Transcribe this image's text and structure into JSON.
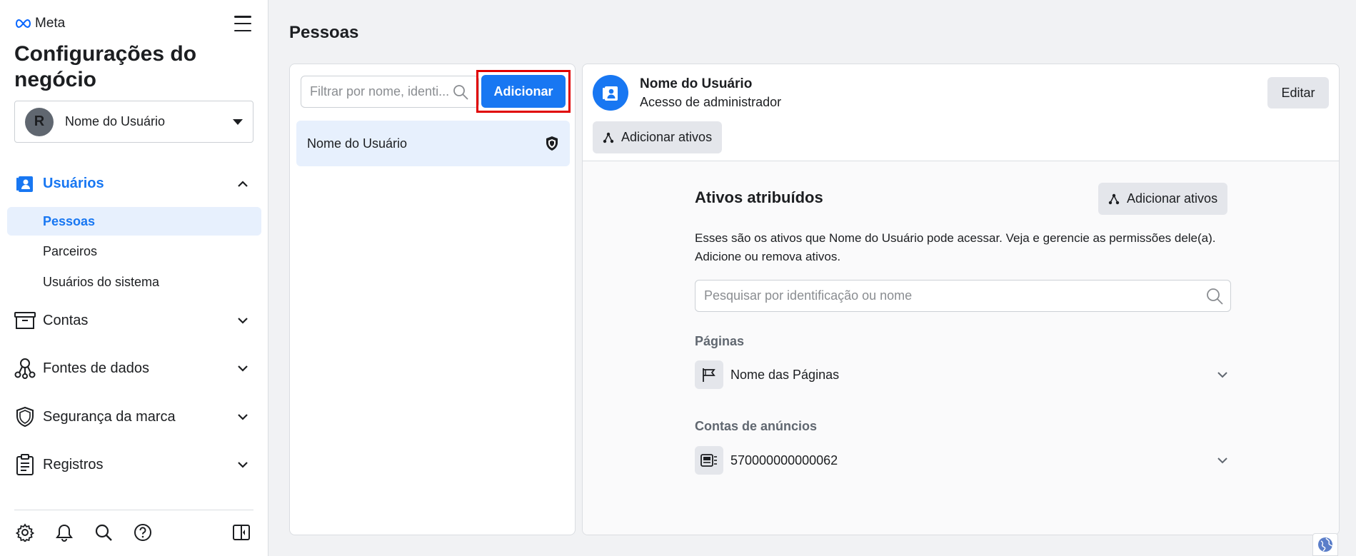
{
  "sidebar": {
    "brand": "Meta",
    "title": "Configurações do negócio",
    "business_selector": {
      "initial": "R",
      "name": "Nome do Usuário"
    },
    "sections": [
      {
        "label": "Usuários",
        "icon": "users-badge-icon",
        "expanded": true,
        "items": [
          {
            "label": "Pessoas",
            "selected": true
          },
          {
            "label": "Parceiros"
          },
          {
            "label": "Usuários do sistema"
          }
        ]
      },
      {
        "label": "Contas",
        "icon": "archive-box-icon"
      },
      {
        "label": "Fontes de dados",
        "icon": "data-sources-icon"
      },
      {
        "label": "Segurança da marca",
        "icon": "shield-icon"
      },
      {
        "label": "Registros",
        "icon": "clipboard-icon"
      }
    ],
    "bottom_icons": [
      "gear-icon",
      "bell-icon",
      "search-icon",
      "help-icon",
      "panel-toggle-icon"
    ]
  },
  "main": {
    "page_title": "Pessoas",
    "list": {
      "filter_placeholder": "Filtrar por nome, identi...",
      "add_button": "Adicionar",
      "rows": [
        {
          "label": "Nome do Usuário",
          "icon": "admin-shield-icon"
        }
      ]
    },
    "detail": {
      "user_name": "Nome do Usuário",
      "user_role": "Acesso de administrador",
      "edit_button": "Editar",
      "add_assets_button": "Adicionar ativos",
      "assets_title": "Ativos atribuídos",
      "assets_description": "Esses são os ativos que Nome do Usuário pode acessar. Veja e gerencie as permissões dele(a). Adicione ou remova ativos.",
      "search_placeholder": "Pesquisar por identificação ou nome",
      "groups": [
        {
          "label": "Páginas",
          "item": "Nome das Páginas",
          "icon": "flag-icon"
        },
        {
          "label": "Contas de anúncios",
          "item": "570000000000062",
          "icon": "ad-account-icon"
        }
      ]
    }
  },
  "colors": {
    "accent": "#1877f2",
    "highlight": "#e00000",
    "selected_bg": "#e7f0fd"
  }
}
